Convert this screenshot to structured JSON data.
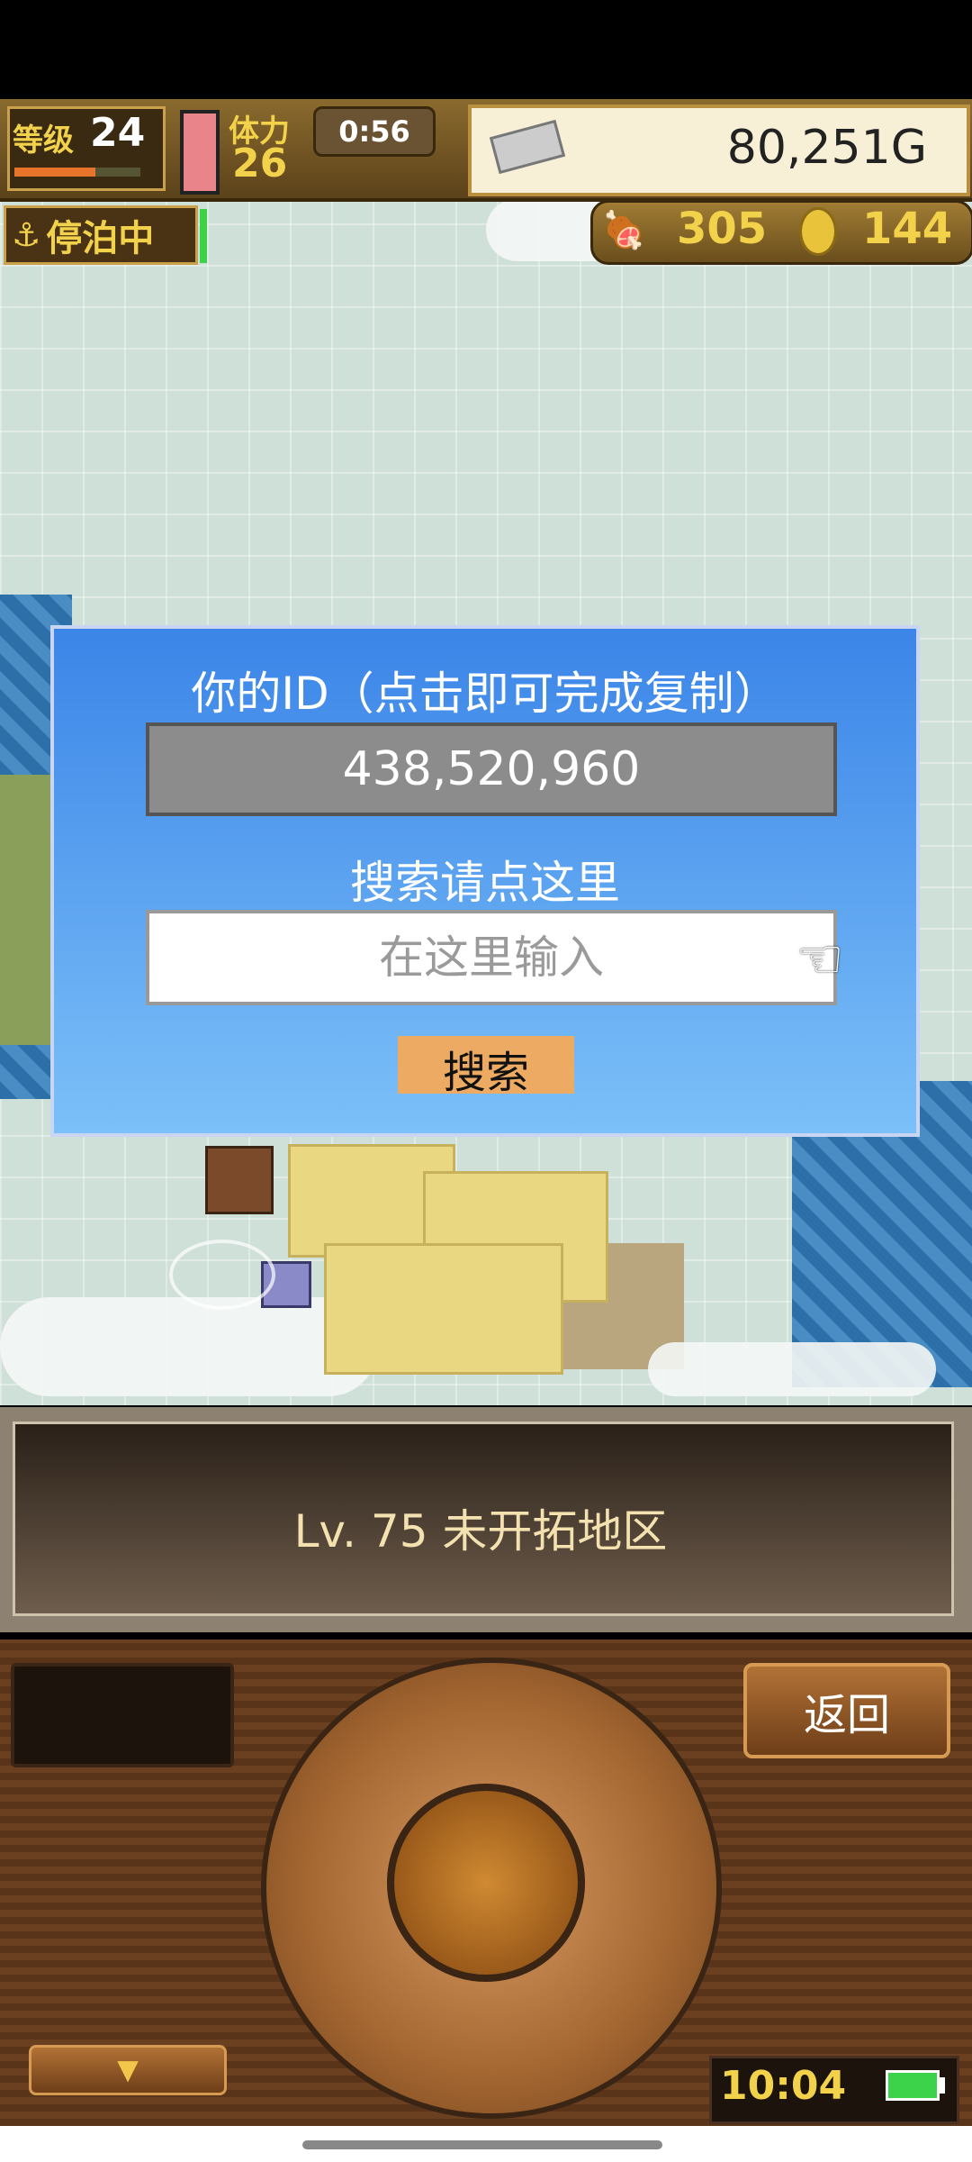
{
  "hud": {
    "level_label": "等级",
    "level_value": "24",
    "stamina_label": "体力",
    "stamina_value": "26",
    "timer": "0:56",
    "gold": "80,251G",
    "status": "停泊中",
    "food": "305",
    "coins": "144"
  },
  "dialog": {
    "title": "你的ID（点击即可完成复制）",
    "id_value": "438,520,960",
    "search_title": "搜索请点这里",
    "search_placeholder": "在这里输入",
    "search_button": "搜索"
  },
  "info": {
    "text": "Lv. 75 未开拓地区"
  },
  "controls": {
    "back_button": "返回",
    "clock": "10:04"
  }
}
